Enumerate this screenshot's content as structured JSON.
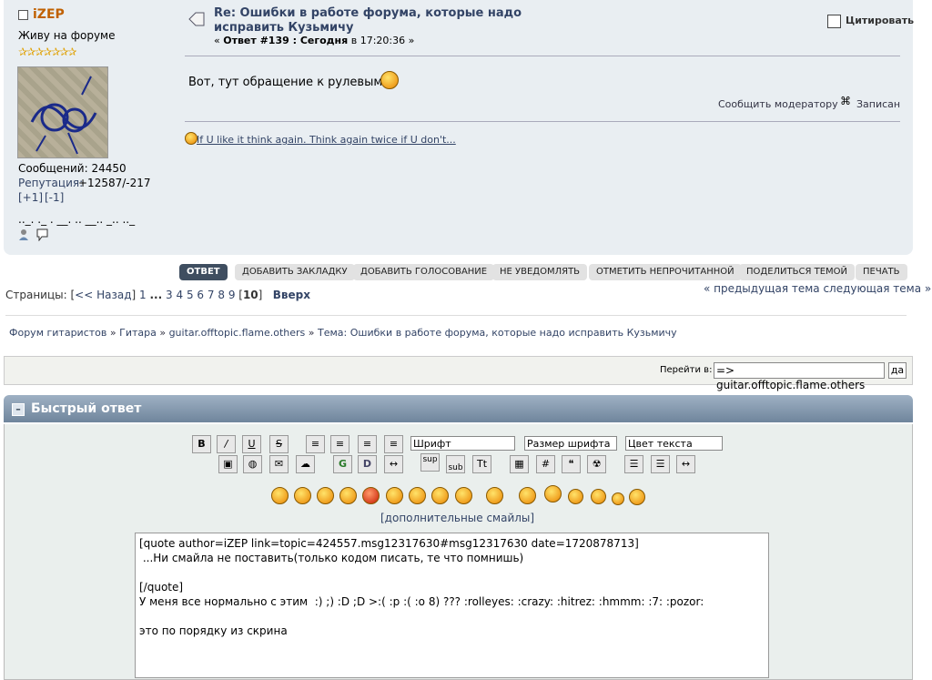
{
  "poster": {
    "name": "iZEP",
    "title": "Живу на форуме",
    "stars": "✰✰✰✰✰✰✰",
    "posts": "Сообщений: 24450",
    "reputation_label": "Репутация:",
    "reputation_value": "+12587/-217",
    "rep_plus": "[+1]",
    "rep_minus": "[-1]",
    "signature_dots": ".._. ._ . __. .. __.. _.. .._"
  },
  "post": {
    "subject_line1": "Re: Ошибки в работе форума, которые надо",
    "subject_line2": "исправить Кузьмичу",
    "meta_prefix": "« ",
    "meta_reply": "Ответ #139 : Сегодня",
    "meta_time": " в 17:20:36 »",
    "quote_button": "Цитировать",
    "body": "Вот, тут обращение к рулевым!",
    "report": "Сообщить модератору",
    "logged": "Записан",
    "signature": "If U like it think again. Think again twice if U don't..."
  },
  "buttons": [
    "ОТВЕТ",
    "ДОБАВИТЬ ЗАКЛАДКУ",
    "ДОБАВИТЬ ГОЛОСОВАНИЕ",
    "НЕ УВЕДОМЛЯТЬ",
    "ОТМЕТИТЬ НЕПРОЧИТАННОЙ",
    "ПОДЕЛИТЬСЯ ТЕМОЙ",
    "ПЕЧАТЬ"
  ],
  "pagination": {
    "label": "Страницы: [",
    "back": "<< Назад",
    "p1": "1",
    "dots": "...",
    "pages": [
      "3",
      "4",
      "5",
      "6",
      "7",
      "8",
      "9"
    ],
    "current": "10",
    "top": "Вверх",
    "prev_next": "« предыдущая тема следующая тема »"
  },
  "breadcrumb": {
    "items": [
      "Форум гитаристов",
      "Гитара",
      "guitar.offtopic.flame.others"
    ],
    "topic": "Тема: Ошибки в работе форума, которые надо исправить Кузьмичу",
    "sep": " » "
  },
  "jump": {
    "label": "Перейти в:",
    "selected": "=> guitar.offtopic.flame.others",
    "go": "да"
  },
  "quick_reply": {
    "title": "Быстрый ответ",
    "collapse": "–",
    "font_select": "Шрифт",
    "size_select": "Размер шрифта",
    "color_select": "Цвет текста",
    "more_smileys": "[дополнительные смайлы]",
    "text": "[quote author=iZEP link=topic=424557.msg12317630#msg12317630 date=1720878713]\n ...Ни смайла не поставить(только кодом писать, те что помнишь)\n\n[/quote]\nУ меня все нормально с этим  :) ;) :D ;D >:( :p :( :o 8) ??? :rolleyes: :crazy: :hitrez: :hmmm: :7: :pozor:\n\nэто по порядку из скрина"
  },
  "toolbar_icons": [
    "bold-icon",
    "italic-icon",
    "underline-icon",
    "strike-icon",
    "align-pre-icon",
    "align-left-icon",
    "align-center-icon",
    "align-right-icon",
    "image-icon",
    "link-icon",
    "email-icon",
    "ftp-icon",
    "glow-icon",
    "shadow-icon",
    "move-icon",
    "superscript-icon",
    "subscript-icon",
    "teletype-icon",
    "table-icon",
    "code-icon",
    "quote-icon",
    "radioactive-icon",
    "list-icon",
    "ordered-list-icon",
    "horizontal-rule-icon"
  ],
  "colors": {
    "accent": "#346",
    "name": "#c06000",
    "header_bg": "#7f93a8",
    "active_button": "#3f4e60"
  }
}
